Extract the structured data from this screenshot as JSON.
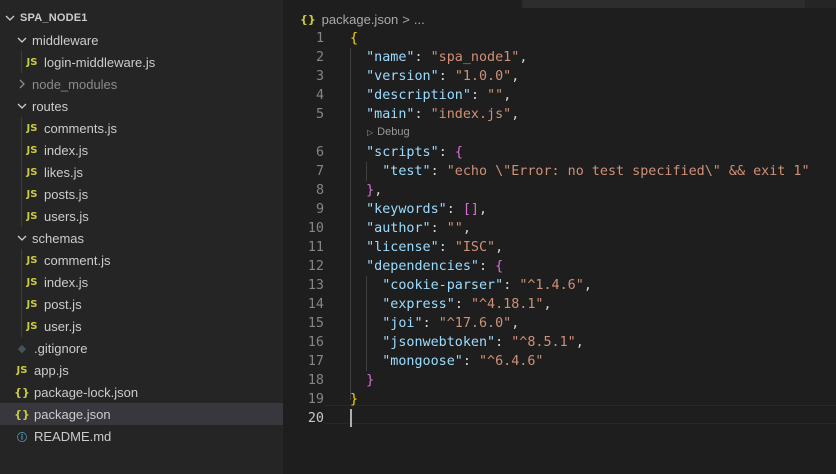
{
  "explorer": {
    "project": "SPA_NODE1",
    "items": [
      {
        "label": "middleware",
        "kind": "folder"
      },
      {
        "label": "login-middleware.js",
        "kind": "js"
      },
      {
        "label": "node_modules",
        "kind": "folder-collapsed"
      },
      {
        "label": "routes",
        "kind": "folder"
      },
      {
        "label": "comments.js",
        "kind": "js"
      },
      {
        "label": "index.js",
        "kind": "js"
      },
      {
        "label": "likes.js",
        "kind": "js"
      },
      {
        "label": "posts.js",
        "kind": "js"
      },
      {
        "label": "users.js",
        "kind": "js"
      },
      {
        "label": "schemas",
        "kind": "folder"
      },
      {
        "label": "comment.js",
        "kind": "js"
      },
      {
        "label": "index.js",
        "kind": "js"
      },
      {
        "label": "post.js",
        "kind": "js"
      },
      {
        "label": "user.js",
        "kind": "js"
      },
      {
        "label": ".gitignore",
        "kind": "git"
      },
      {
        "label": "app.js",
        "kind": "js"
      },
      {
        "label": "package-lock.json",
        "kind": "json"
      },
      {
        "label": "package.json",
        "kind": "json",
        "selected": true
      },
      {
        "label": "README.md",
        "kind": "info"
      }
    ],
    "icons": {
      "js": "JS",
      "json": "{}",
      "info": "ⓘ",
      "git": "◆"
    }
  },
  "breadcrumb": {
    "file": "package.json",
    "separator": ">",
    "rest": "..."
  },
  "editor": {
    "codelens": "Debug",
    "line_numbers": [
      "1",
      "2",
      "3",
      "4",
      "5",
      "6",
      "7",
      "8",
      "9",
      "10",
      "11",
      "12",
      "13",
      "14",
      "15",
      "16",
      "17",
      "18",
      "19",
      "20"
    ],
    "active_line": "20",
    "lines": {
      "l1_open": "{",
      "name_key": "\"name\"",
      "name_val": "\"spa_node1\"",
      "version_key": "\"version\"",
      "version_val": "\"1.0.0\"",
      "description_key": "\"description\"",
      "description_val": "\"\"",
      "main_key": "\"main\"",
      "main_val": "\"index.js\"",
      "scripts_key": "\"scripts\"",
      "scripts_open": "{",
      "test_key": "\"test\"",
      "test_val": "\"echo \\\"Error: no test specified\\\" && exit 1\"",
      "scripts_close": "}",
      "keywords_key": "\"keywords\"",
      "keywords_val": "[]",
      "author_key": "\"author\"",
      "author_val": "\"\"",
      "license_key": "\"license\"",
      "license_val": "\"ISC\"",
      "deps_key": "\"dependencies\"",
      "deps_open": "{",
      "cookie_key": "\"cookie-parser\"",
      "cookie_val": "\"^1.4.6\"",
      "express_key": "\"express\"",
      "express_val": "\"^4.18.1\"",
      "joi_key": "\"joi\"",
      "joi_val": "\"^17.6.0\"",
      "jwt_key": "\"jsonwebtoken\"",
      "jwt_val": "\"^8.5.1\"",
      "mongoose_key": "\"mongoose\"",
      "mongoose_val": "\"^6.4.6\"",
      "deps_close": "}",
      "l19_close": "}"
    }
  },
  "colors": {
    "sidebar_bg": "#252526",
    "editor_bg": "#1e1e1e",
    "selection_bg": "#37373d",
    "json_key": "#9cdcfe",
    "json_string": "#ce9178",
    "bracket_level1": "#ffd700",
    "bracket_level2": "#da70d6",
    "js_icon": "#cbcb41"
  }
}
